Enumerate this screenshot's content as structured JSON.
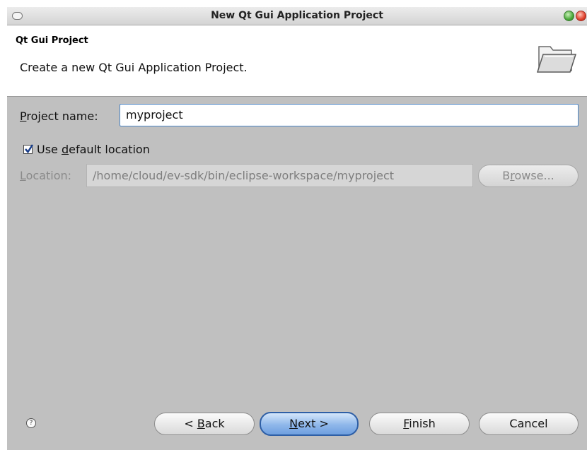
{
  "window": {
    "title": "New Qt Gui Application Project"
  },
  "banner": {
    "heading": "Qt Gui Project",
    "description": "Create a new Qt Gui Application Project.",
    "icon": "folder-icon"
  },
  "form": {
    "project_name_label_mnemonic": "P",
    "project_name_label_rest": "roject name:",
    "project_name_value": "myproject",
    "use_default_prefix": "Use ",
    "use_default_mnemonic": "d",
    "use_default_rest": "efault location",
    "use_default_checked": true,
    "location_label_mnemonic": "L",
    "location_label_rest": "ocation:",
    "location_value": "/home/cloud/ev-sdk/bin/eclipse-workspace/myproject",
    "browse_prefix": "B",
    "browse_mnemonic": "r",
    "browse_rest": "owse..."
  },
  "footer": {
    "help_icon": "?",
    "back_prefix": "< ",
    "back_mnemonic": "B",
    "back_rest": "ack",
    "next_mnemonic": "N",
    "next_rest": "ext >",
    "finish_mnemonic": "F",
    "finish_rest": "inish",
    "cancel_label": "Cancel"
  },
  "colors": {
    "window_bg": "#c0c0c0",
    "accent": "#4a84c4",
    "close_button": "#e0412d",
    "minimize_button": "#4aa83a"
  }
}
